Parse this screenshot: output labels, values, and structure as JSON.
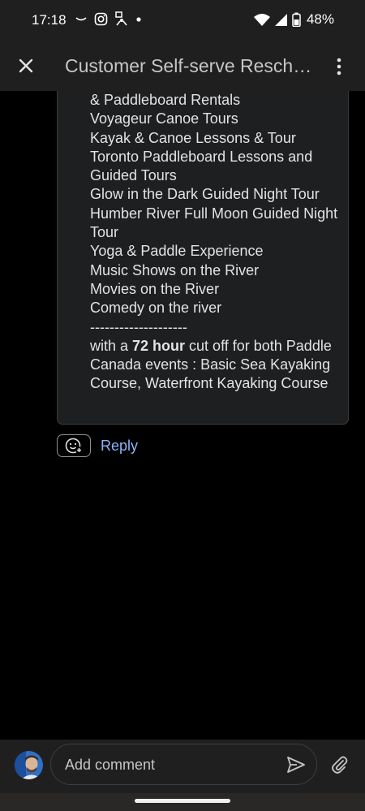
{
  "status_bar": {
    "time": "17:18",
    "battery": "48%",
    "notification_icons": [
      "arc-icon",
      "instagram-icon",
      "app-notification-icon",
      "dot-icon"
    ]
  },
  "app_bar": {
    "title": "Customer Self-serve Resch…"
  },
  "comment": {
    "lines": [
      "& Paddleboard Rentals",
      "Voyageur Canoe Tours",
      "Kayak & Canoe Lessons & Tour",
      "Toronto Paddleboard Lessons and",
      "Guided Tours",
      "Glow in the Dark Guided Night Tour",
      "Humber River Full Moon Guided Night",
      "Tour",
      "Yoga & Paddle Experience",
      "Music Shows on the River",
      "Movies on the River",
      "Comedy on the river",
      "--------------------"
    ],
    "cutoff_prefix": "with a ",
    "cutoff_bold": "72 hour",
    "cutoff_suffix": " cut off for both Paddle",
    "tail_lines": [
      "Canada events : Basic Sea Kayaking",
      "Course, Waterfront Kayaking Course"
    ]
  },
  "actions": {
    "reply_label": "Reply"
  },
  "composer": {
    "placeholder": "Add comment"
  },
  "colors": {
    "background": "#000000",
    "bar": "#1f1f1f",
    "card": "#1e1f20",
    "link": "#8ab4f8",
    "text": "#e3e3e3"
  }
}
